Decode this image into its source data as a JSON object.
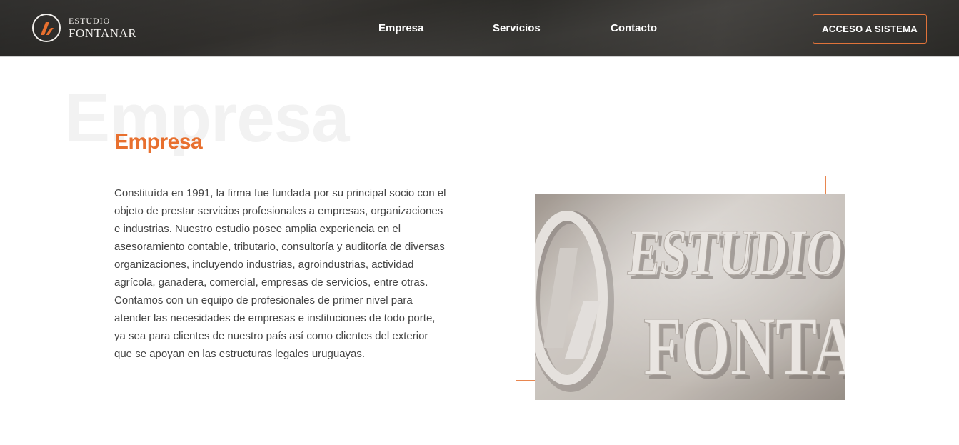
{
  "header": {
    "logo": {
      "top": "ESTUDIO",
      "bottom": "FONTANAR"
    },
    "nav": [
      {
        "label": "Empresa"
      },
      {
        "label": "Servicios"
      },
      {
        "label": "Contacto"
      }
    ],
    "cta_label": "ACCESO A SISTEMA"
  },
  "main": {
    "watermark": "Empresa",
    "title": "Empresa",
    "paragraph": "Constituída en 1991, la firma fue fundada por su principal socio con el objeto de prestar servicios profesionales a empresas, organizaciones e industrias. Nuestro estudio posee amplia experiencia en el asesoramiento contable, tributario, consultoría y auditoría de diversas organizaciones, incluyendo industrias, agroindustrias, actividad agrícola, ganadera, comercial, empresas de servicios, entre otras. Contamos con un equipo de profesionales de primer nivel para atender las necesidades de empresas e instituciones de todo porte, ya sea para clientes de nuestro país así como clientes del exterior que se apoyan en las estructuras legales uruguayas.",
    "photo": {
      "sign_line1": "ESTUDIO",
      "sign_line2": "FONTA"
    }
  },
  "colors": {
    "accent": "#e8702f",
    "header_bg": "#2e2d2a",
    "text": "#444444"
  },
  "icons": {
    "logo_mark": "estudio-fontanar-logo-icon"
  }
}
